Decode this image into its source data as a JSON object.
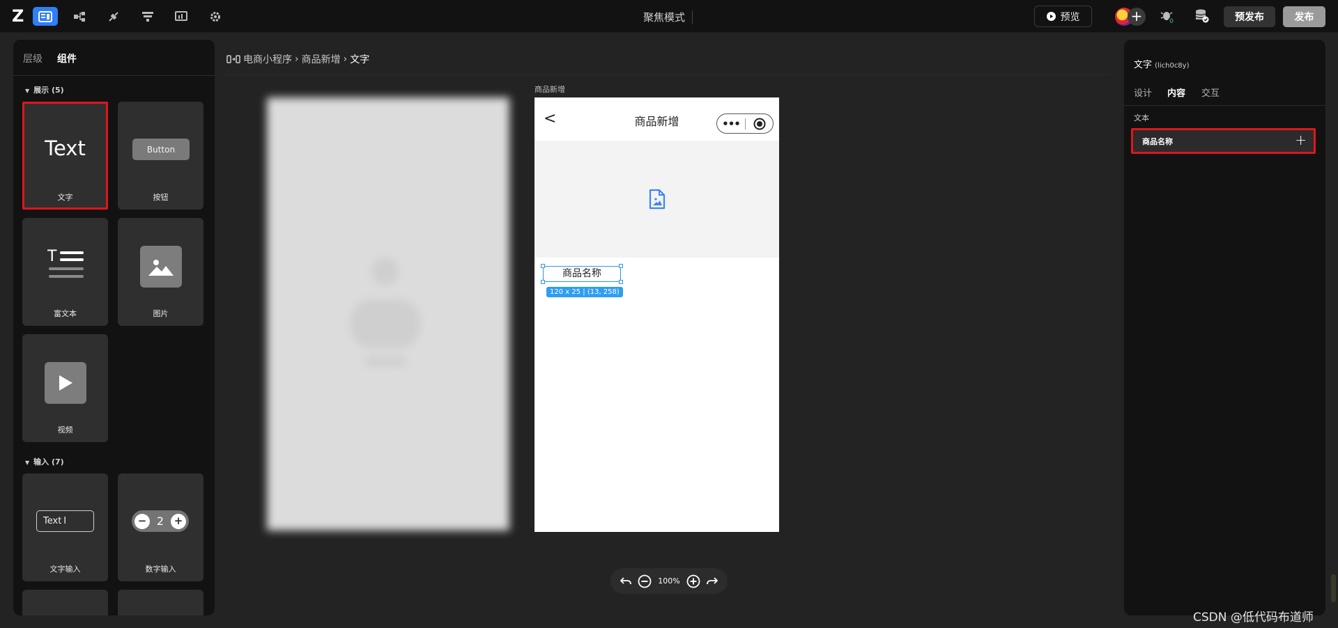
{
  "topbar": {
    "logo": "Z",
    "focus_mode": "聚焦模式",
    "preview_label": "预览",
    "prepublish_label": "预发布",
    "publish_label": "发布",
    "accent_color": "#2f7ff6",
    "tool_icons": [
      "page-layout-icon",
      "flow-icon",
      "plugin-icon",
      "data-icon",
      "chart-icon",
      "gear-icon"
    ],
    "bug_badge": "0"
  },
  "left_panel": {
    "tabs": [
      "层级",
      "组件"
    ],
    "active_tab": "组件",
    "sections": [
      {
        "title": "展示 (5)"
      },
      {
        "title": "输入 (7)"
      }
    ],
    "components": {
      "text": {
        "label": "文字",
        "preview": "Text"
      },
      "button": {
        "label": "按钮",
        "preview": "Button"
      },
      "richtext": {
        "label": "富文本"
      },
      "image": {
        "label": "图片"
      },
      "video": {
        "label": "视频"
      },
      "text_input": {
        "label": "文字输入",
        "preview": "Text"
      },
      "number_input": {
        "label": "数字输入",
        "preview_value": "2"
      }
    }
  },
  "breadcrumb": {
    "icon": "page-flow-icon",
    "items": [
      "电商小程序",
      "商品新增",
      "文字"
    ],
    "separator": "›"
  },
  "canvas": {
    "page_label": "商品新增",
    "phone": {
      "title": "商品新增",
      "back": "<",
      "capsule_dots": "•••",
      "selected_text": "商品名称",
      "size_tip": "120 x 25 | (13, 258)"
    },
    "zoom": "100%"
  },
  "right_panel": {
    "title": "文字",
    "component_id": "(lich0c8y)",
    "tabs": [
      "设计",
      "内容",
      "交互"
    ],
    "active_tab": "内容",
    "section": "文本",
    "field_value": "商品名称",
    "field_add": "+"
  },
  "watermark": "CSDN @低代码布道师"
}
